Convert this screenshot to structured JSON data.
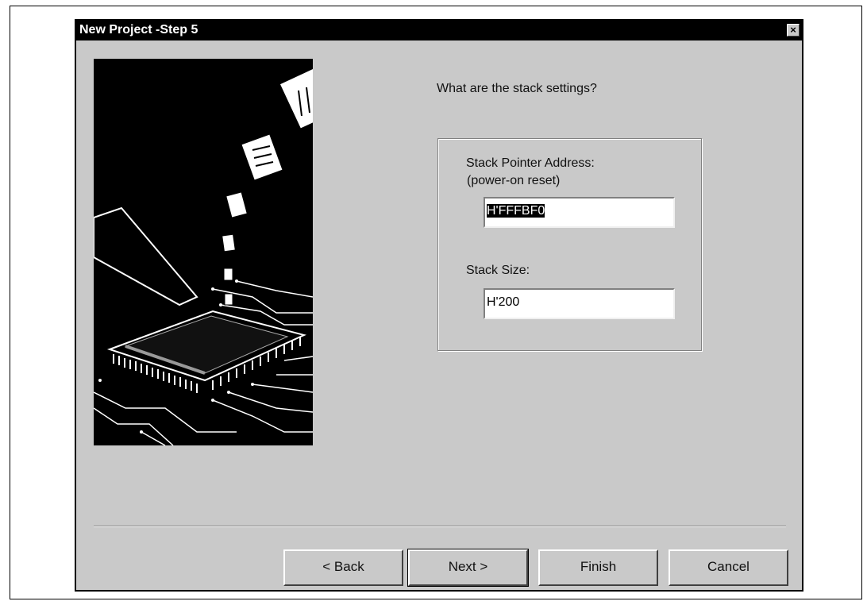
{
  "window": {
    "title": "New Project -Step 5",
    "close_glyph": "×"
  },
  "main": {
    "question": "What are the stack settings?",
    "stack_pointer": {
      "label_line1": "Stack Pointer Address:",
      "label_line2": "(power-on reset)",
      "value": "H'FFFBF0"
    },
    "stack_size": {
      "label": "Stack Size:",
      "value": "H'200"
    }
  },
  "buttons": {
    "back": "< Back",
    "next": "Next >",
    "finish": "Finish",
    "cancel": "Cancel"
  }
}
